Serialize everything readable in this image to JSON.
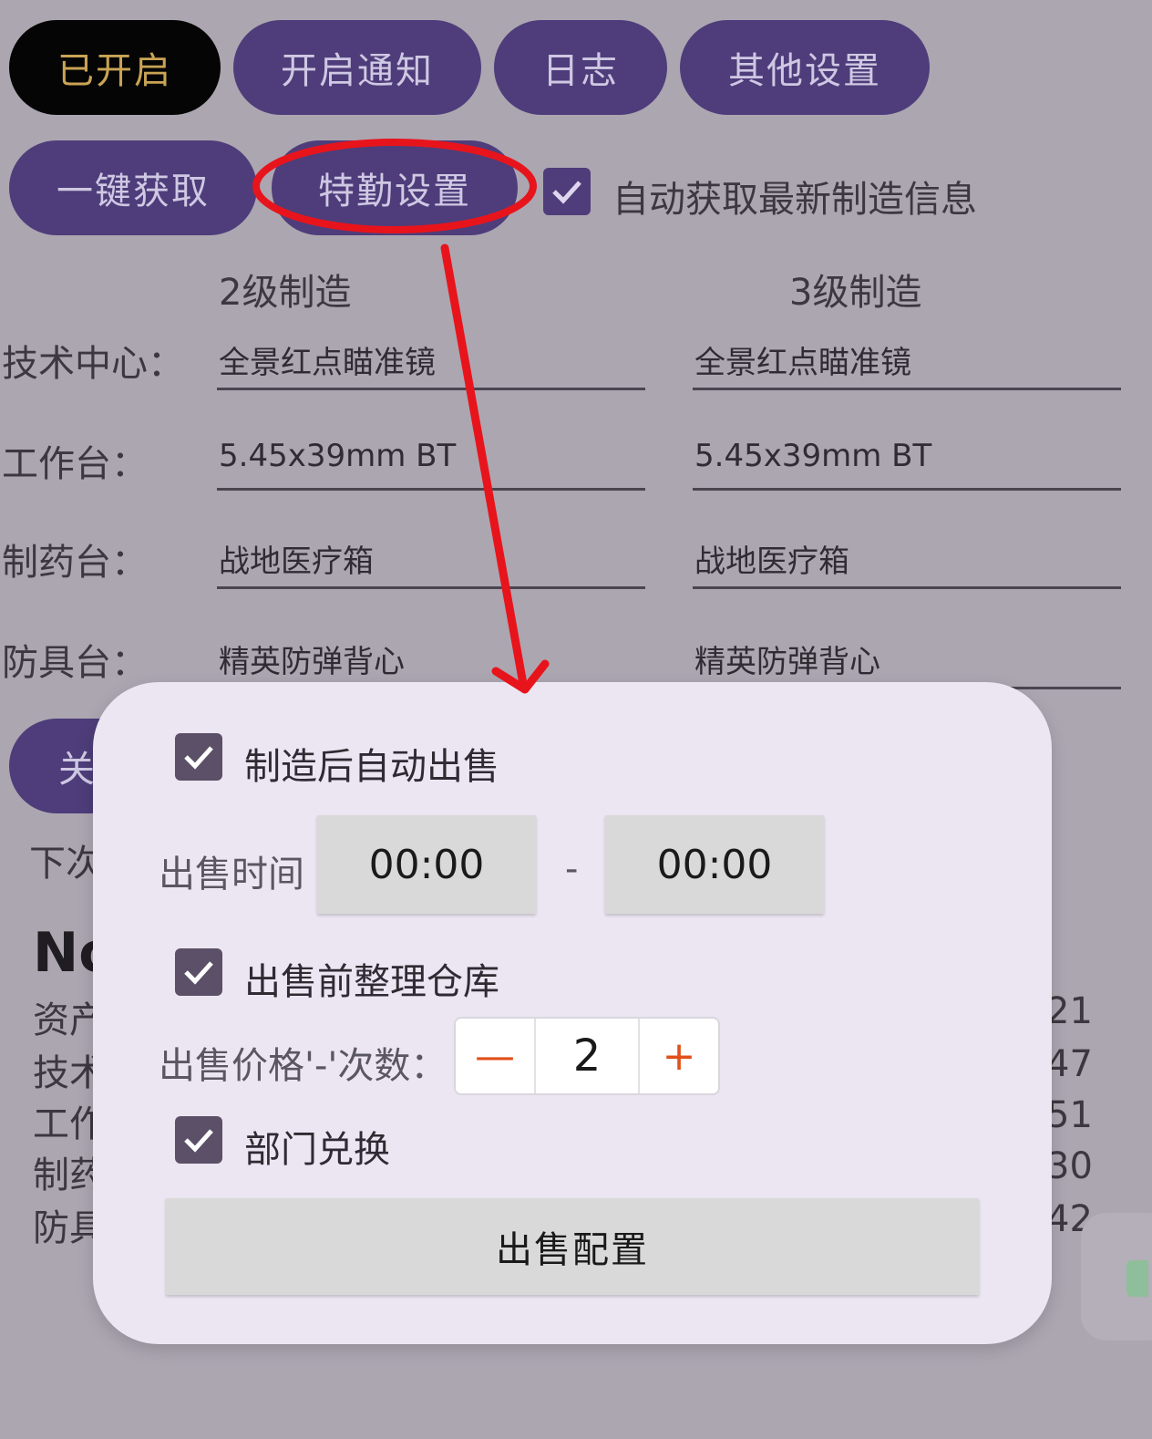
{
  "top_tabs": {
    "enabled": "已开启",
    "notify": "开启通知",
    "log": "日志",
    "other": "其他设置"
  },
  "toolbar": {
    "one_click": "一键获取",
    "special": "特勤设置",
    "auto_fetch_label": "自动获取最新制造信息",
    "auto_fetch_checked": true
  },
  "craft": {
    "col2": "2级制造",
    "col3": "3级制造",
    "rows": [
      {
        "label": "技术中心：",
        "lvl2": "全景红点瞄准镜",
        "lvl3": "全景红点瞄准镜"
      },
      {
        "label": "工作台：",
        "lvl2": "5.45x39mm BT",
        "lvl3": "5.45x39mm BT"
      },
      {
        "label": "制药台：",
        "lvl2": "战地医疗箱",
        "lvl3": "战地医疗箱"
      },
      {
        "label": "防具台：",
        "lvl2": "精英防弹背心",
        "lvl3": "精英防弹背心"
      }
    ]
  },
  "background_partial": {
    "button": "关",
    "next": "下次",
    "heading": "No",
    "list": [
      "资产",
      "技术",
      "工作",
      "制药",
      "防具"
    ],
    "right_numbers": [
      "21",
      "47",
      "51",
      "30",
      "42"
    ]
  },
  "dialog": {
    "auto_sell_label": "制造后自动出售",
    "auto_sell_checked": true,
    "sell_time_label": "出售时间",
    "time_start": "00:00",
    "time_sep": "-",
    "time_end": "00:00",
    "tidy_label": "出售前整理仓库",
    "tidy_checked": true,
    "price_label": "出售价格'-'次数：",
    "minus": "—",
    "count": "2",
    "plus": "+",
    "dept_label": "部门兑换",
    "dept_checked": true,
    "config_button": "出售配置"
  },
  "annotation_color": "#e8141c"
}
